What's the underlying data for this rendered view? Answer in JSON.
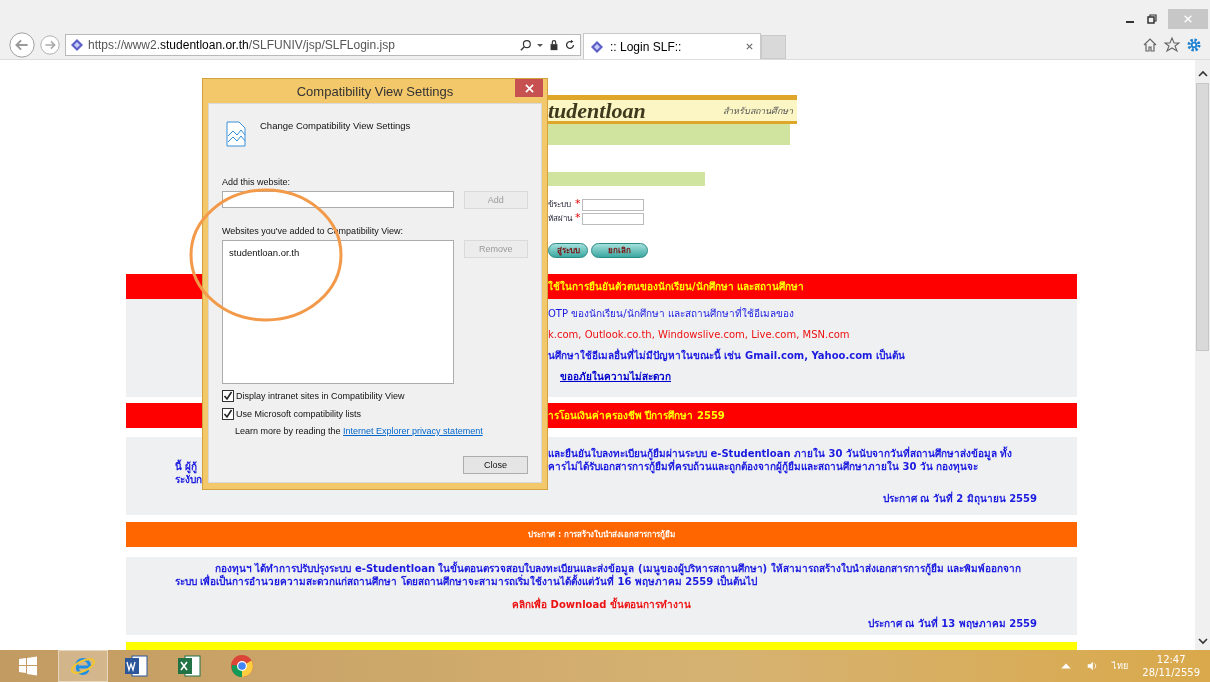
{
  "browser": {
    "url": "https://www2.**studentloan.or.th**/SLFUNIV/jsp/SLFLogin.jsp",
    "tabs": [
      {
        "title": ":: Login SLF::",
        "selected": true
      }
    ]
  },
  "page": {
    "banner": {
      "logo": "tudentloan",
      "subtitle": "สำหรับสถานศึกษา"
    },
    "login": {
      "fields": [
        {
          "label": "ข้ระบบ",
          "mark": "*"
        },
        {
          "label": "หัสผ่าน",
          "mark": "*"
        }
      ],
      "buttons": [
        "สู่ระบบ",
        "ยกเลิก"
      ]
    },
    "sections": [
      {
        "kind": "red",
        "heading": "ใช้ในการยืนยันตัวตนของนักเรียน/นักศึกษา และสถานศึกษา",
        "lines": [
          {
            "kind": "blue",
            "text": "OTP ของนักเรียน/นักศึกษา และสถานศึกษาที่ใช้อีเมลของ"
          },
          {
            "kind": "red",
            "text": "k.com, Outlook.co.th, Windowslive.com, Live.com, MSN.com"
          },
          {
            "kind": "bold",
            "text": "นศึกษาใช้อีเมลอื่นที่ไม่มีปัญหาในขณะนี้ เช่น Gmail.com, Yahoo.com เป็นต้น"
          },
          {
            "kind": "link",
            "text": "ขออภัยในความไม่สะดวก"
          }
        ]
      },
      {
        "kind": "red",
        "heading": "ารโอนเงินค่าครองชีพ ปีการศึกษา 2559",
        "lines": [
          {
            "kind": "bold",
            "text": "และยืนยันใบลงทะเบียนกู้ยืมผ่านระบบ e-Studentloan ภายใน 30 วันนับจากวันที่สถานศึกษาส่งข้อมูล ทั้ง"
          },
          {
            "kind": "split",
            "left": "นี้ ผู้กู้",
            "text": "คารไม่ได้รับเอกสารการกู้ยืมที่ครบถ้วนและถูกต้องจากผู้กู้ยืมและสถานศึกษาภายใน 30 วัน กองทุนจะ"
          },
          {
            "kind": "left",
            "text": "ระงับก"
          },
          {
            "kind": "date",
            "text": "ประกาศ ณ วันที่ 2 มิถุนายน 2559"
          }
        ]
      },
      {
        "kind": "orange",
        "heading": "ประกาศ : การสร้างใบนำส่งเอกสารการกู้ยืม",
        "lines": [
          {
            "kind": "para",
            "text": "กองทุนฯ ได้ทำการปรับปรุงระบบ e-Studentloan ในขั้นตอนตรวจสอบใบลงทะเบียนและส่งข้อมูล (เมนูของผู้บริหารสถานศึกษา) ให้สามารถสร้างใบนำส่งเอกสารการกู้ยืม และพิมพ์ออกจากระบบ เพื่อเป็นการอำนวยความสะดวกแก่สถานศึกษา โดยสถานศึกษาจะสามารถเริ่มใช้งานได้ตั้งแต่วันที่ 16 พฤษภาคม 2559 เป็นต้นไป"
          },
          {
            "kind": "download",
            "text": "คลิกเพื่อ Download ขั้นตอนการทำงาน"
          },
          {
            "kind": "date",
            "text": "ประกาศ ณ วันที่ 13 พฤษภาคม 2559"
          }
        ]
      },
      {
        "kind": "yellow"
      }
    ]
  },
  "dialog": {
    "title": "Compatibility View Settings",
    "header": "Change Compatibility View Settings",
    "add_label": "Add this website:",
    "add_button": {
      "label": "Add",
      "disabled": true
    },
    "list_label": "Websites you've added to Compatibility View:",
    "sites": [
      {
        "name": "studentloan.or.th",
        "selected": false
      }
    ],
    "remove_button": {
      "label": "Remove",
      "disabled": true
    },
    "options": [
      {
        "label": "Display intranet sites in Compatibility View",
        "checked": true
      },
      {
        "label": "Use Microsoft compatibility lists",
        "checked": true
      }
    ],
    "learn_more": "Learn more by reading the",
    "privacy_link": "Internet Explorer privacy statement",
    "close_button": "Close"
  },
  "taskbar": {
    "apps": [
      {
        "kind": "ie",
        "selected": true
      },
      {
        "kind": "word",
        "selected": false
      },
      {
        "kind": "excel",
        "selected": false
      },
      {
        "kind": "chrome",
        "selected": false
      }
    ],
    "language": "ไทย",
    "time": "12:47",
    "date": "28/11/2559"
  }
}
